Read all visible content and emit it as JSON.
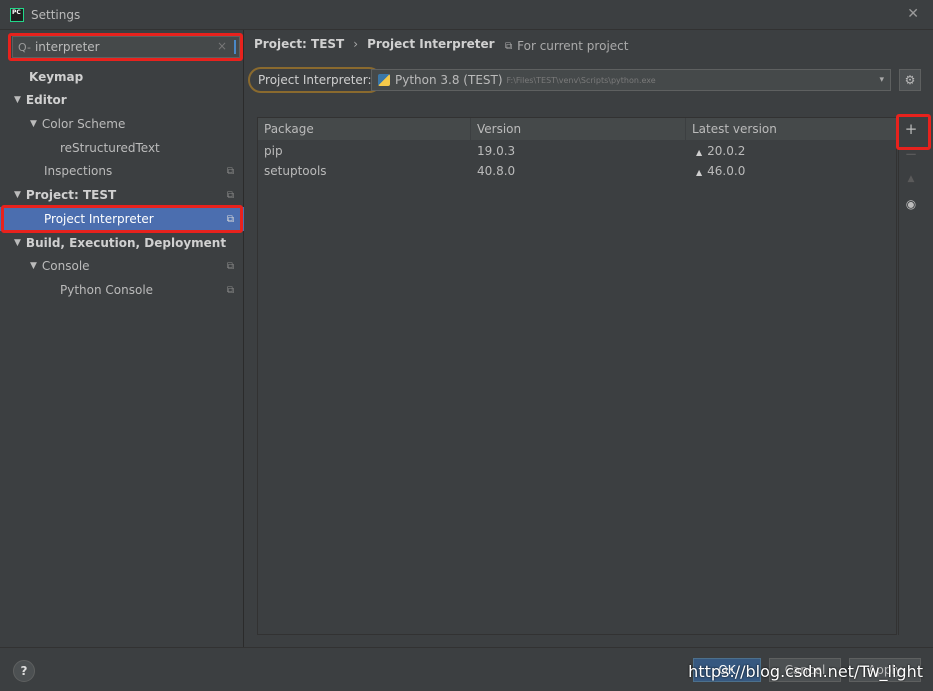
{
  "window": {
    "title": "Settings",
    "close": "✕"
  },
  "search": {
    "value": "interpreter",
    "icon": "Q-",
    "clear": "×"
  },
  "sidebar": {
    "items": [
      {
        "label": "Keymap",
        "tri": "",
        "copy": ""
      },
      {
        "label": "Editor",
        "tri": "▼",
        "copy": ""
      },
      {
        "label": "Color Scheme",
        "tri": "▼",
        "copy": ""
      },
      {
        "label": "reStructuredText",
        "tri": "",
        "copy": ""
      },
      {
        "label": "Inspections",
        "tri": "",
        "copy": "⧉"
      },
      {
        "label": "Project: TEST",
        "tri": "▼",
        "copy": "⧉"
      },
      {
        "label": "Project Interpreter",
        "tri": "",
        "copy": "⧉"
      },
      {
        "label": "Build, Execution, Deployment",
        "tri": "▼",
        "copy": ""
      },
      {
        "label": "Console",
        "tri": "▼",
        "copy": "⧉"
      },
      {
        "label": "Python Console",
        "tri": "",
        "copy": "⧉"
      }
    ]
  },
  "breadcrumb": {
    "parent": "Project: TEST",
    "sep": "›",
    "current": "Project Interpreter"
  },
  "for_current": {
    "icon": "⧉",
    "label": "For current project"
  },
  "interpreter": {
    "label": "Project Interpreter:",
    "name": "Python 3.8 (TEST)",
    "path": "F:\\Files\\TEST\\venv\\Scripts\\python.exe",
    "arrow": "▾",
    "gear": "⚙"
  },
  "packages": {
    "headers": [
      "Package",
      "Version",
      "Latest version"
    ],
    "rows": [
      {
        "package": "pip",
        "version": "19.0.3",
        "latest_mark": "▲",
        "latest": "20.0.2"
      },
      {
        "package": "setuptools",
        "version": "40.8.0",
        "latest_mark": "▲",
        "latest": "46.0.0"
      }
    ]
  },
  "tools": {
    "add": "+",
    "remove": "−",
    "upgrade": "▲",
    "show": "◉"
  },
  "footer": {
    "help": "?",
    "ok": "OK",
    "cancel": "Cancel",
    "apply": "Apply",
    "watermark": "https://blog.csdn.net/Tw_light"
  },
  "colors": {
    "highlight": "#e8221d",
    "selection": "#4b6eaf",
    "background": "#3c3f41"
  }
}
